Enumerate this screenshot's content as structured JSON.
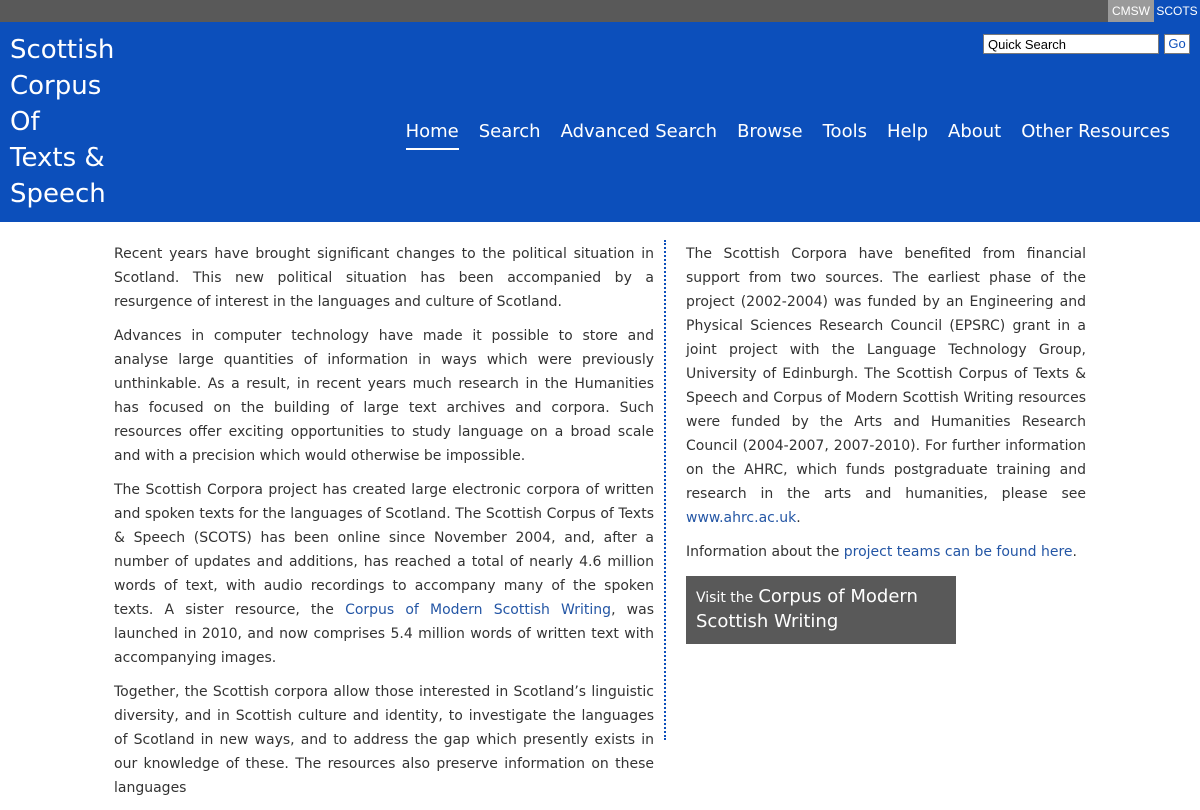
{
  "topbar": {
    "cmsw": "CMSW",
    "scots": "SCOTS"
  },
  "header": {
    "title_lines": [
      "Scottish",
      "Corpus",
      "Of",
      "Texts &",
      "Speech"
    ],
    "search": {
      "value": "Quick Search",
      "go": "Go"
    },
    "nav": [
      "Home",
      "Search",
      "Advanced Search",
      "Browse",
      "Tools",
      "Help",
      "About",
      "Other Resources"
    ]
  },
  "left": {
    "p1": "Recent years have brought significant changes to the political situation in Scotland. This new political situation has been accompanied by a resurgence of interest in the languages and culture of Scotland.",
    "p2": "Advances in computer technology have made it possible to store and analyse large quantities of information in ways which were previously unthinkable. As a result, in recent years much research in the Humanities has focused on the building of large text archives and corpora. Such resources offer exciting opportunities to study language on a broad scale and with a precision which would otherwise be impossible.",
    "p3_a": "The Scottish Corpora project has created large electronic corpora of written and spoken texts for the languages of Scotland. The Scottish Corpus of Texts & Speech (SCOTS) has been online since November 2004, and, after a number of updates and additions, has reached a total of nearly 4.6 million words of text, with audio recordings to accompany many of the spoken texts. A sister resource, the ",
    "p3_link": "Corpus of Modern Scottish Writing",
    "p3_b": ", was launched in 2010, and now comprises 5.4 million words of written text with accompanying images.",
    "p4": "Together, the Scottish corpora allow those interested in Scotland’s linguistic diversity, and in Scottish culture and identity, to investigate the languages of Scotland in new ways, and to address the gap which presently exists in our knowledge of these. The resources also preserve information on these languages"
  },
  "right": {
    "p1": "The Scottish Corpora have benefited from financial support from two sources. The earliest phase of the project (2002-2004) was funded by an Engineering and Physical Sciences Research Council (EPSRC) grant in a joint project with the Language Technology Group, University of Edinburgh. The Scottish Corpus of Texts & Speech and Corpus of Modern Scottish Writing resources were funded by the Arts and Humanities Research Council (2004-2007, 2007-2010). For further information on the AHRC, which funds postgraduate training and research in the arts and humanities, please see ",
    "p1_link": "www.ahrc.ac.uk",
    "p1_end": ".",
    "p2_a": "Information about the ",
    "p2_link": "project teams can be found here",
    "p2_end": ".",
    "cta_small": "Visit the",
    "cta_big": "Corpus of Modern Scottish Writing"
  },
  "colors": {
    "brand_blue": "#0c4fbb",
    "dark_grey": "#595959",
    "link": "#2456a5"
  }
}
